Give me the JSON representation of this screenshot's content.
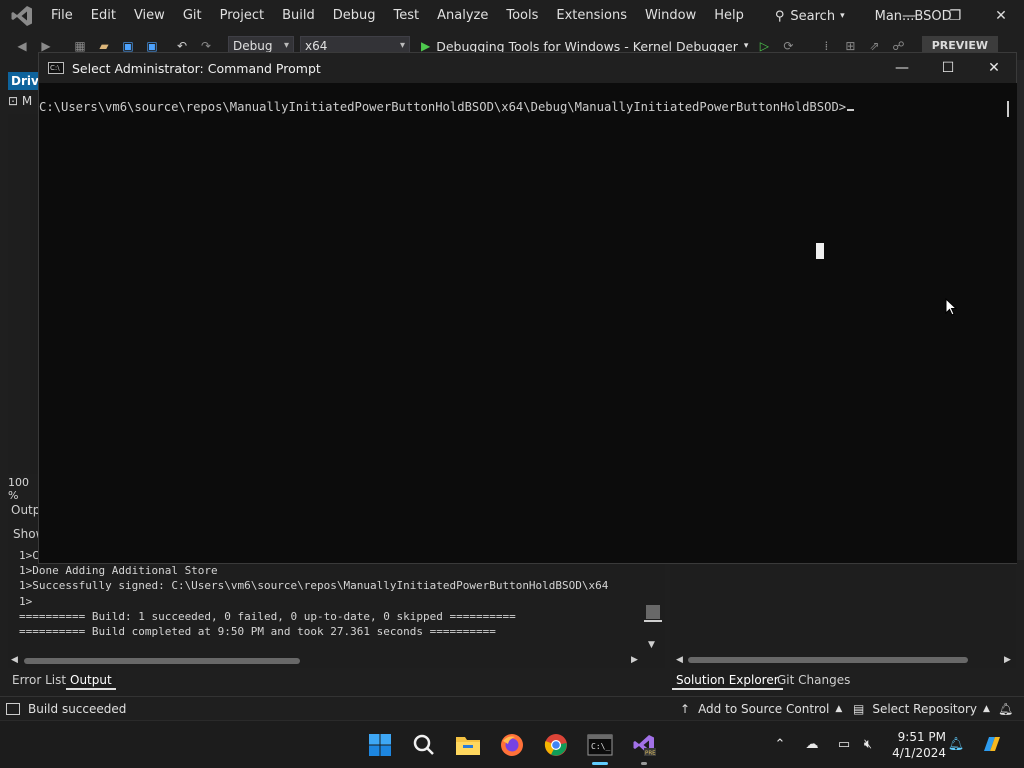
{
  "vs": {
    "menu": [
      "File",
      "Edit",
      "View",
      "Git",
      "Project",
      "Build",
      "Debug",
      "Test",
      "Analyze",
      "Tools",
      "Extensions",
      "Window",
      "Help"
    ],
    "search_label": "Search",
    "solution_name": "Man...BSOD",
    "toolbar": {
      "config": "Debug",
      "platform": "x64",
      "debug_target": "Debugging Tools for Windows - Kernel Debugger",
      "preview_badge": "PREVIEW"
    },
    "doc_tab": "Drive",
    "doc_nav": "M",
    "zoom": "100 %",
    "output": {
      "title": "Outp",
      "show_label": "Show",
      "lines": [
        "1>C",
        "1>Done Adding Additional Store",
        "1>Successfully signed: C:\\Users\\vm6\\source\\repos\\ManuallyInitiatedPowerButtonHoldBSOD\\x64",
        "1>",
        "========== Build: 1 succeeded, 0 failed, 0 up-to-date, 0 skipped ==========",
        "========== Build completed at 9:50 PM and took 27.361 seconds =========="
      ]
    },
    "bottom_tabs": {
      "error_list": "Error List",
      "output": "Output",
      "solution_explorer": "Solution Explorer",
      "git_changes": "Git Changes"
    },
    "status": {
      "build": "Build succeeded",
      "source_control": "Add to Source Control",
      "repository": "Select Repository"
    }
  },
  "cmd": {
    "title": "Select Administrator: Command Prompt",
    "prompt": "C:\\Users\\vm6\\source\\repos\\ManuallyInitiatedPowerButtonHoldBSOD\\x64\\Debug\\ManuallyInitiatedPowerButtonHoldBSOD>"
  },
  "taskbar": {
    "time": "9:51 PM",
    "date": "4/1/2024"
  },
  "colors": {
    "vs_background": "#1f1f1f",
    "cmd_background": "#0c0c0c",
    "accent_blue": "#0e639c",
    "taskbar_accent": "#60cdff"
  }
}
